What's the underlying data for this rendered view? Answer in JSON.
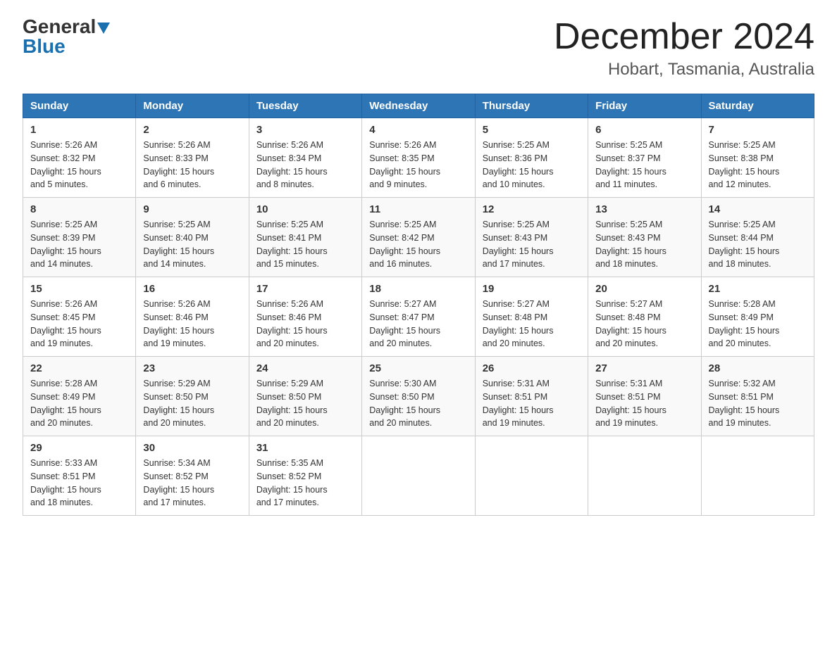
{
  "header": {
    "logo_general": "General",
    "logo_blue": "Blue",
    "month_title": "December 2024",
    "location": "Hobart, Tasmania, Australia"
  },
  "days_of_week": [
    "Sunday",
    "Monday",
    "Tuesday",
    "Wednesday",
    "Thursday",
    "Friday",
    "Saturday"
  ],
  "weeks": [
    [
      {
        "day": "1",
        "sunrise": "5:26 AM",
        "sunset": "8:32 PM",
        "daylight": "15 hours and 5 minutes."
      },
      {
        "day": "2",
        "sunrise": "5:26 AM",
        "sunset": "8:33 PM",
        "daylight": "15 hours and 6 minutes."
      },
      {
        "day": "3",
        "sunrise": "5:26 AM",
        "sunset": "8:34 PM",
        "daylight": "15 hours and 8 minutes."
      },
      {
        "day": "4",
        "sunrise": "5:26 AM",
        "sunset": "8:35 PM",
        "daylight": "15 hours and 9 minutes."
      },
      {
        "day": "5",
        "sunrise": "5:25 AM",
        "sunset": "8:36 PM",
        "daylight": "15 hours and 10 minutes."
      },
      {
        "day": "6",
        "sunrise": "5:25 AM",
        "sunset": "8:37 PM",
        "daylight": "15 hours and 11 minutes."
      },
      {
        "day": "7",
        "sunrise": "5:25 AM",
        "sunset": "8:38 PM",
        "daylight": "15 hours and 12 minutes."
      }
    ],
    [
      {
        "day": "8",
        "sunrise": "5:25 AM",
        "sunset": "8:39 PM",
        "daylight": "15 hours and 14 minutes."
      },
      {
        "day": "9",
        "sunrise": "5:25 AM",
        "sunset": "8:40 PM",
        "daylight": "15 hours and 14 minutes."
      },
      {
        "day": "10",
        "sunrise": "5:25 AM",
        "sunset": "8:41 PM",
        "daylight": "15 hours and 15 minutes."
      },
      {
        "day": "11",
        "sunrise": "5:25 AM",
        "sunset": "8:42 PM",
        "daylight": "15 hours and 16 minutes."
      },
      {
        "day": "12",
        "sunrise": "5:25 AM",
        "sunset": "8:43 PM",
        "daylight": "15 hours and 17 minutes."
      },
      {
        "day": "13",
        "sunrise": "5:25 AM",
        "sunset": "8:43 PM",
        "daylight": "15 hours and 18 minutes."
      },
      {
        "day": "14",
        "sunrise": "5:25 AM",
        "sunset": "8:44 PM",
        "daylight": "15 hours and 18 minutes."
      }
    ],
    [
      {
        "day": "15",
        "sunrise": "5:26 AM",
        "sunset": "8:45 PM",
        "daylight": "15 hours and 19 minutes."
      },
      {
        "day": "16",
        "sunrise": "5:26 AM",
        "sunset": "8:46 PM",
        "daylight": "15 hours and 19 minutes."
      },
      {
        "day": "17",
        "sunrise": "5:26 AM",
        "sunset": "8:46 PM",
        "daylight": "15 hours and 20 minutes."
      },
      {
        "day": "18",
        "sunrise": "5:27 AM",
        "sunset": "8:47 PM",
        "daylight": "15 hours and 20 minutes."
      },
      {
        "day": "19",
        "sunrise": "5:27 AM",
        "sunset": "8:48 PM",
        "daylight": "15 hours and 20 minutes."
      },
      {
        "day": "20",
        "sunrise": "5:27 AM",
        "sunset": "8:48 PM",
        "daylight": "15 hours and 20 minutes."
      },
      {
        "day": "21",
        "sunrise": "5:28 AM",
        "sunset": "8:49 PM",
        "daylight": "15 hours and 20 minutes."
      }
    ],
    [
      {
        "day": "22",
        "sunrise": "5:28 AM",
        "sunset": "8:49 PM",
        "daylight": "15 hours and 20 minutes."
      },
      {
        "day": "23",
        "sunrise": "5:29 AM",
        "sunset": "8:50 PM",
        "daylight": "15 hours and 20 minutes."
      },
      {
        "day": "24",
        "sunrise": "5:29 AM",
        "sunset": "8:50 PM",
        "daylight": "15 hours and 20 minutes."
      },
      {
        "day": "25",
        "sunrise": "5:30 AM",
        "sunset": "8:50 PM",
        "daylight": "15 hours and 20 minutes."
      },
      {
        "day": "26",
        "sunrise": "5:31 AM",
        "sunset": "8:51 PM",
        "daylight": "15 hours and 19 minutes."
      },
      {
        "day": "27",
        "sunrise": "5:31 AM",
        "sunset": "8:51 PM",
        "daylight": "15 hours and 19 minutes."
      },
      {
        "day": "28",
        "sunrise": "5:32 AM",
        "sunset": "8:51 PM",
        "daylight": "15 hours and 19 minutes."
      }
    ],
    [
      {
        "day": "29",
        "sunrise": "5:33 AM",
        "sunset": "8:51 PM",
        "daylight": "15 hours and 18 minutes."
      },
      {
        "day": "30",
        "sunrise": "5:34 AM",
        "sunset": "8:52 PM",
        "daylight": "15 hours and 17 minutes."
      },
      {
        "day": "31",
        "sunrise": "5:35 AM",
        "sunset": "8:52 PM",
        "daylight": "15 hours and 17 minutes."
      },
      null,
      null,
      null,
      null
    ]
  ],
  "labels": {
    "sunrise_prefix": "Sunrise: ",
    "sunset_prefix": "Sunset: ",
    "daylight_prefix": "Daylight: "
  }
}
